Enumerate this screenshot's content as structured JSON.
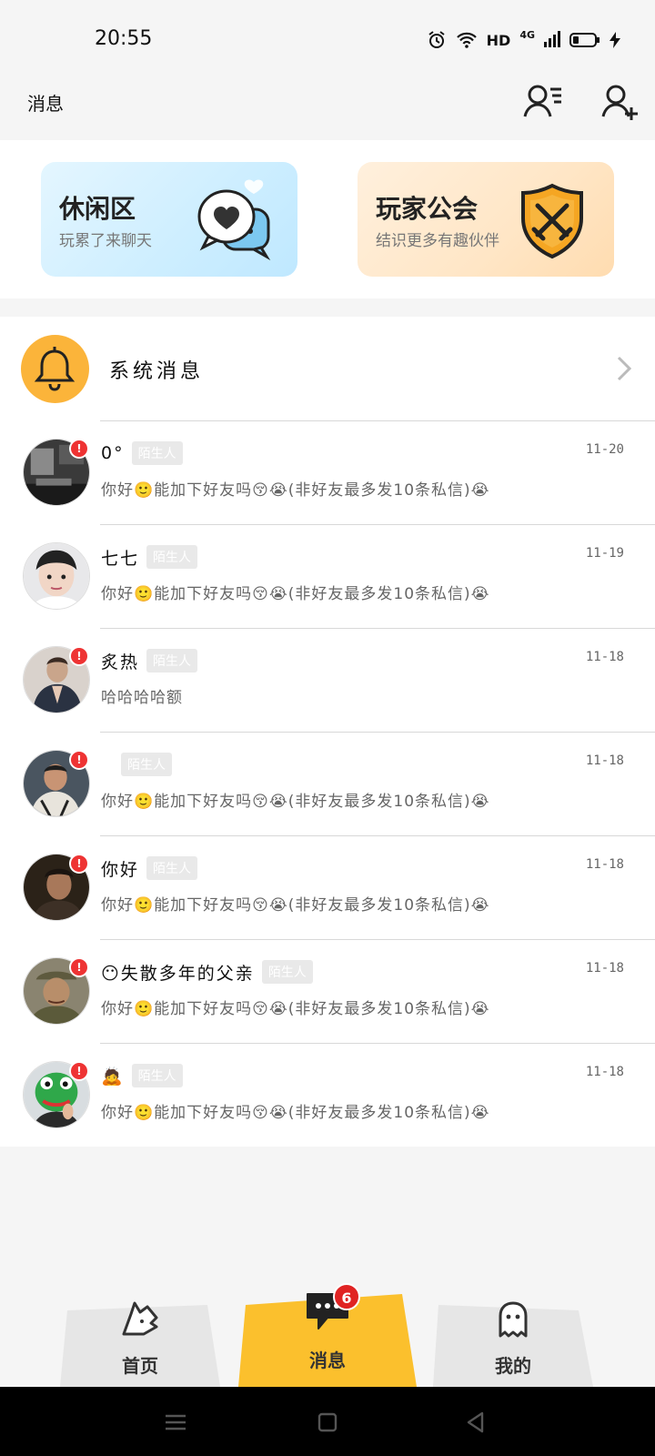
{
  "status_bar": {
    "time": "20:55",
    "network_label": "HD",
    "signal_label": "4G"
  },
  "header": {
    "title": "消息"
  },
  "cards": [
    {
      "title": "休闲区",
      "subtitle": "玩累了来聊天"
    },
    {
      "title": "玩家公会",
      "subtitle": "结识更多有趣伙伴"
    }
  ],
  "system_messages": {
    "title": "系统消息"
  },
  "messages": [
    {
      "name": "0°",
      "badge": "陌生人",
      "preview": "你好🙂能加下好友吗😚😭(非好友最多发10条私信)😭",
      "time": "11-20",
      "unread": "!"
    },
    {
      "name": "七七",
      "badge": "陌生人",
      "preview": "你好🙂能加下好友吗😚😭(非好友最多发10条私信)😭",
      "time": "11-19",
      "unread": ""
    },
    {
      "name": "炙热",
      "badge": "陌生人",
      "preview": "哈哈哈哈额",
      "time": "11-18",
      "unread": "!"
    },
    {
      "name": "",
      "badge": "陌生人",
      "preview": "你好🙂能加下好友吗😚😭(非好友最多发10条私信)😭",
      "time": "11-18",
      "unread": "!"
    },
    {
      "name": "你好",
      "badge": "陌生人",
      "preview": "你好🙂能加下好友吗😚😭(非好友最多发10条私信)😭",
      "time": "11-18",
      "unread": "!"
    },
    {
      "name": "😶失散多年的父亲",
      "badge": "陌生人",
      "preview": "你好🙂能加下好友吗😚😭(非好友最多发10条私信)😭",
      "time": "11-18",
      "unread": "!"
    },
    {
      "name": "🙇",
      "badge": "陌生人",
      "preview": "你好🙂能加下好友吗😚😭(非好友最多发10条私信)😭",
      "time": "11-18",
      "unread": "!"
    }
  ],
  "bottom_nav": {
    "home": "首页",
    "messages": "消息",
    "mine": "我的",
    "messages_count": "6"
  },
  "colors": {
    "accent": "#fbc02d",
    "unread": "#ee3333",
    "bell_bg": "#fbb43a"
  }
}
